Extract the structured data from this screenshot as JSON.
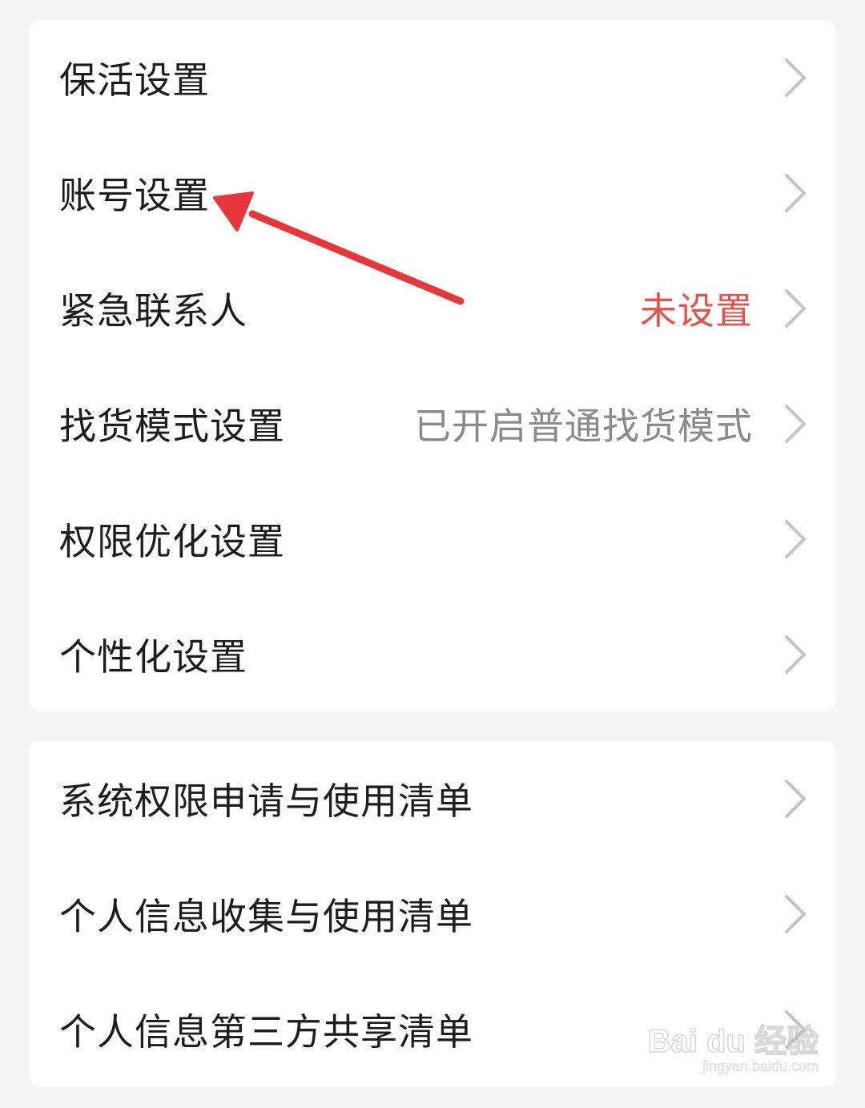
{
  "group1": {
    "items": [
      {
        "label": "保活设置",
        "value": ""
      },
      {
        "label": "账号设置",
        "value": ""
      },
      {
        "label": "紧急联系人",
        "value": "未设置"
      },
      {
        "label": "找货模式设置",
        "value": "已开启普通找货模式"
      },
      {
        "label": "权限优化设置",
        "value": ""
      },
      {
        "label": "个性化设置",
        "value": ""
      }
    ]
  },
  "group2": {
    "items": [
      {
        "label": "系统权限申请与使用清单"
      },
      {
        "label": "个人信息收集与使用清单"
      },
      {
        "label": "个人信息第三方共享清单"
      }
    ]
  },
  "colors": {
    "background": "#f4f4f4",
    "card": "#ffffff",
    "label_text": "#1d1d1d",
    "value_text": "#8a8a8a",
    "alert_text": "#e8504a",
    "chevron": "#c4c4c4",
    "annotation_arrow": "#e8373a"
  },
  "icons": {
    "row_arrow": "chevron-right-icon",
    "annotation": "red-arrow-pointer"
  },
  "watermark": {
    "logo": "Bai du 经验",
    "url": "jingyan.baidu.com"
  }
}
